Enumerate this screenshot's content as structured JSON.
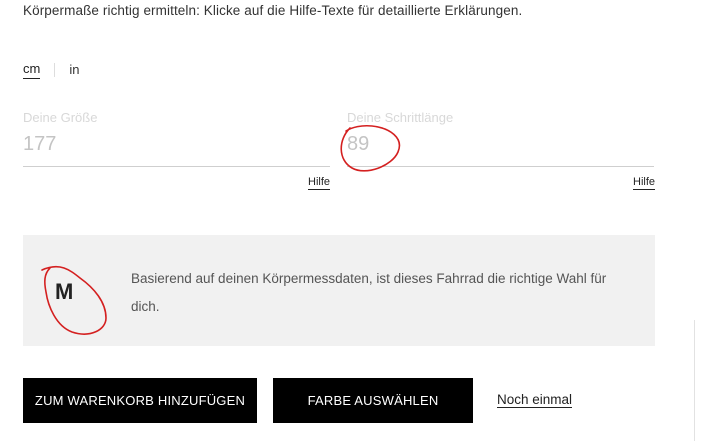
{
  "intro": {
    "text": "Körpermaße richtig ermitteln: Klicke auf die Hilfe-Texte für detaillierte Erklärungen."
  },
  "units": {
    "cm": "cm",
    "in": "in",
    "selected": "cm"
  },
  "fields": {
    "height": {
      "label": "Deine Größe",
      "value": "177"
    },
    "inseam": {
      "label": "Deine Schrittlänge",
      "value": "89"
    }
  },
  "help": {
    "height_label": "Hilfe",
    "inseam_label": "Hilfe"
  },
  "result": {
    "size": "M",
    "text": "Basierend auf deinen Körpermessdaten, ist dieses Fahrrad die richtige Wahl für dich."
  },
  "actions": {
    "add_to_cart": "ZUM WARENKORB HINZUFÜGEN",
    "choose_color": "FARBE AUSWÄHLEN",
    "again": "Noch einmal"
  },
  "colors": {
    "annotation": "#d42020",
    "button_bg": "#000000",
    "result_bg": "#f1f1f1"
  }
}
